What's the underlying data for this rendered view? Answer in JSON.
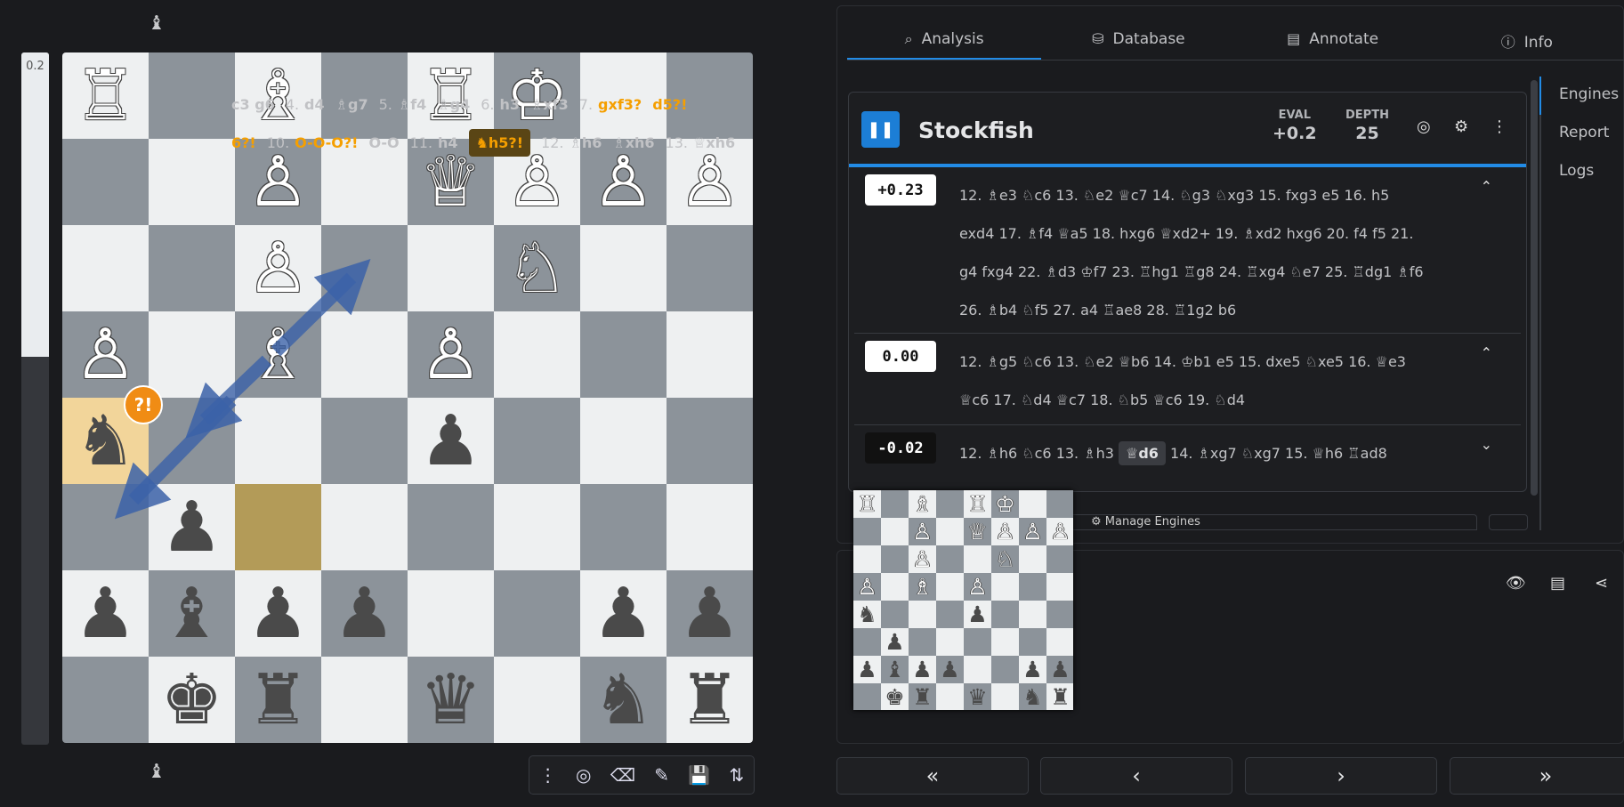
{
  "eval_bar": {
    "label": "0.2",
    "white_fraction": 0.44
  },
  "board": {
    "rows": [
      [
        "♖",
        "",
        "♗",
        "",
        "♖",
        "♔",
        "",
        ""
      ],
      [
        "",
        "",
        "♙",
        "",
        "♕",
        "♙",
        "♙",
        "♙"
      ],
      [
        "",
        "",
        "♙",
        "",
        "",
        "♘",
        "",
        ""
      ],
      [
        "♙",
        "",
        "♗",
        "",
        "♙",
        "",
        "",
        ""
      ],
      [
        "♞",
        "",
        "",
        "",
        "♟",
        "",
        "",
        ""
      ],
      [
        "",
        "♟",
        "",
        "",
        "",
        "",
        "",
        ""
      ],
      [
        "♟",
        "♝",
        "♟",
        "♟",
        "",
        "",
        "♟",
        "♟"
      ],
      [
        "",
        "♚",
        "♜",
        "",
        "♛",
        "",
        "♞",
        "♜"
      ]
    ],
    "highlight_move_square": [
      4,
      0
    ],
    "highlight_last_square": [
      5,
      2
    ],
    "badge": "?!"
  },
  "side_icons": {
    "top": "♝",
    "bottom": "♝"
  },
  "toolbar_icons": [
    "⋮",
    "◎",
    "⌫",
    "✎",
    "💾",
    "⇅"
  ],
  "tabs": [
    {
      "icon": "⌕",
      "label": "Analysis"
    },
    {
      "icon": "⛁",
      "label": "Database"
    },
    {
      "icon": "▤",
      "label": "Annotate"
    },
    {
      "icon": "ⓘ",
      "label": "Info"
    }
  ],
  "side_menu": [
    "Engines",
    "Report",
    "Logs"
  ],
  "engine": {
    "pause_icon": "❚❚",
    "name": "Stockfish",
    "eval_label": "EVAL",
    "eval_value": "+0.2",
    "depth_label": "DEPTH",
    "depth_value": "25",
    "lines": [
      {
        "score": "+0.23",
        "tone": "w",
        "chevron": "⌃",
        "moves": "12. ♗e3 ♘c6 13. ♘e2 ♕c7 14. ♘g3 ♘xg3 15. fxg3 e5 16. h5 exd4 17. ♗f4 ♕a5 18. hxg6 ♕xd2+ 19. ♗xd2 hxg6 20. f4 f5 21. g4 fxg4 22. ♗d3 ♔f7 23. ♖hg1 ♖g8 24. ♖xg4 ♘e7 25. ♖dg1 ♗f6 26. ♗b4 ♘f5 27. a4 ♖ae8 28. ♖1g2 b6"
      },
      {
        "score": "0.00",
        "tone": "w",
        "chevron": "⌃",
        "moves": "12. ♗g5 ♘c6 13. ♘e2 ♕b6 14. ♔b1 e5 15. dxe5 ♘xe5 16. ♕e3 ♕c6 17. ♘d4 ♕c7 18. ♘b5 ♕c6 19. ♘d4"
      },
      {
        "score": "-0.02",
        "tone": "b",
        "chevron": "⌄",
        "moves_before": "12. ♗h6 ♘c6 13. ♗h3",
        "current": "♕d6",
        "moves_after": "14. ♗xg7 ♘xg7 15. ♕h6 ♖ad8"
      }
    ]
  },
  "hidden_row": "⚙  Manage Engines",
  "game_panel_icons": [
    "👁",
    "▤",
    "⋖"
  ],
  "game_moves": {
    "row1": [
      {
        "t": "c3 g6",
        "k": "b"
      },
      {
        "t": "4.",
        "k": "n"
      },
      {
        "t": "d4",
        "k": "b"
      },
      {
        "t": "♗g7",
        "k": "b"
      },
      {
        "t": "5.",
        "k": "n"
      },
      {
        "t": "♗f4",
        "k": "b"
      },
      {
        "t": "♗g4",
        "k": "b"
      },
      {
        "t": "6.",
        "k": "n"
      },
      {
        "t": "h3",
        "k": "b"
      },
      {
        "t": "♗xf3",
        "k": "b"
      },
      {
        "t": "7.",
        "k": "n"
      },
      {
        "t": "gxf3?",
        "k": "q"
      },
      {
        "t": "d5?!",
        "k": "q"
      }
    ],
    "row2": [
      {
        "t": "6?!",
        "k": "q"
      },
      {
        "t": "10.",
        "k": "n"
      },
      {
        "t": "O-O-O?!",
        "k": "q"
      },
      {
        "t": "O-O",
        "k": "b"
      },
      {
        "t": "11.",
        "k": "n"
      },
      {
        "t": "h4",
        "k": "b"
      },
      {
        "t": "♞h5?!",
        "k": "cur"
      },
      {
        "t": "12.",
        "k": "n"
      },
      {
        "t": "♗h6",
        "k": "b"
      },
      {
        "t": "♗xh6",
        "k": "b"
      },
      {
        "t": "13.",
        "k": "n"
      },
      {
        "t": "♕xh6",
        "k": "b"
      }
    ]
  },
  "nav_buttons": [
    "«",
    "‹",
    "›",
    "»"
  ]
}
